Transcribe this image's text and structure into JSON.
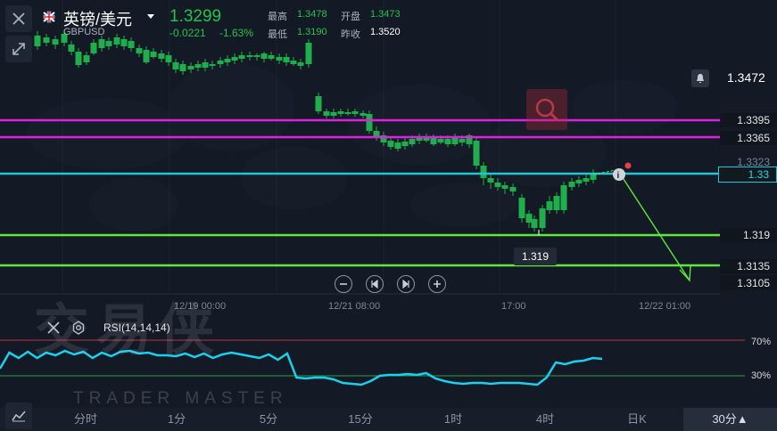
{
  "header": {
    "pair_name": "英镑/美元",
    "symbol": "GBPUSD",
    "price": "1.3299",
    "change": "-0.0221",
    "change_pct": "-1.63%",
    "stats": {
      "high_label": "最高",
      "high": "1.3478",
      "open_label": "开盘",
      "open": "1.3473",
      "low_label": "最低",
      "low": "1.3190",
      "prev_label": "昨收",
      "prev": "1.3520"
    }
  },
  "price_axis": {
    "alert_level": "1.3472",
    "levels": [
      {
        "value": "1.3395",
        "color": "#e020e0"
      },
      {
        "value": "1.3365",
        "color": "#e020e0"
      },
      {
        "value": "1.3323",
        "color": "#ffffff"
      },
      {
        "value": "1.33",
        "color": "#22c5d8"
      },
      {
        "value": "1.319",
        "color": "#5ee93a"
      },
      {
        "value": "1.3135",
        "color": "#5ee93a"
      },
      {
        "value": "1.3105",
        "color": "#5ee93a"
      }
    ],
    "low_marker": "1.319"
  },
  "time_axis": [
    "12/19 00:00",
    "12/21 08:00",
    "17:00",
    "12/22 01:00"
  ],
  "rsi": {
    "label": "RSI(14,14,14)",
    "upper": "70%",
    "lower": "30%",
    "values": [
      38,
      56,
      50,
      57,
      50,
      56,
      53,
      58,
      54,
      57,
      50,
      56,
      52,
      57,
      58,
      55,
      56,
      53,
      53,
      52,
      55,
      51,
      55,
      50,
      54,
      56,
      54,
      52,
      50,
      54,
      48,
      55,
      28,
      27,
      28,
      28,
      26,
      22,
      21,
      20,
      24,
      30,
      31,
      31,
      32,
      31,
      33,
      27,
      24,
      22,
      21,
      22,
      22,
      21,
      22,
      22,
      22,
      21,
      20,
      28,
      45,
      43,
      46,
      47,
      50,
      49
    ]
  },
  "watermark": {
    "main": "交易侠",
    "sub": "TRADER MASTER"
  },
  "timeframes": [
    "分时",
    "1分",
    "5分",
    "15分",
    "1时",
    "4时",
    "日K",
    "30分▲"
  ],
  "active_timeframe": "30分▲",
  "colors": {
    "up": "#f0524f",
    "down": "#1fae4b",
    "magenta": "#e020e0",
    "cyan": "#22c5d8",
    "green_line": "#5ee93a",
    "background": "#141a25"
  }
}
